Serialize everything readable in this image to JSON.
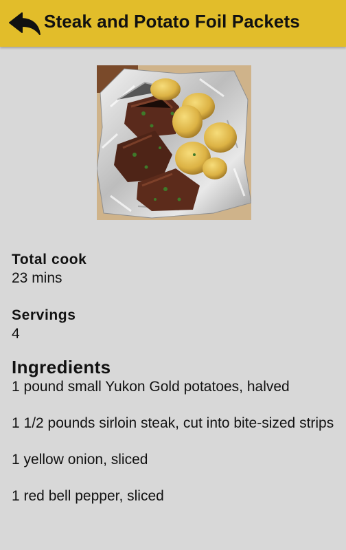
{
  "header": {
    "title": "Steak and Potato Foil Packets",
    "background": "#e2bd2a"
  },
  "icons": {
    "back": "reply-arrow-icon"
  },
  "image": {
    "subject": "steak-and-potato-foil-packet-photo"
  },
  "details": {
    "total_cook_label": "Total cook",
    "total_cook_value": "23 mins",
    "servings_label": "Servings",
    "servings_value": "4"
  },
  "ingredients": {
    "title": "Ingredients",
    "items": [
      "1 pound small Yukon Gold potatoes, halved",
      "1 1/2 pounds sirloin steak, cut into bite-sized strips",
      "1 yellow onion, sliced",
      "1 red bell pepper, sliced"
    ]
  }
}
